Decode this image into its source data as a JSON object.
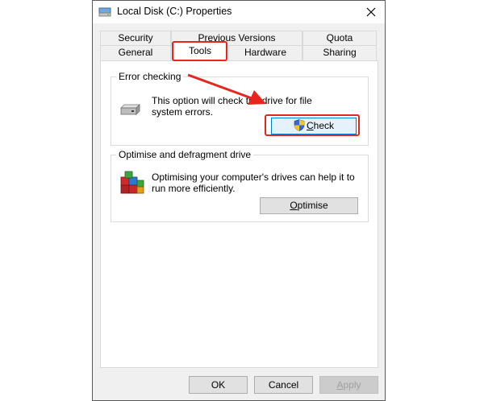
{
  "window": {
    "title": "Local Disk (C:) Properties"
  },
  "tabs_row1": [
    {
      "label": "Security"
    },
    {
      "label": "Previous Versions"
    },
    {
      "label": "Quota"
    }
  ],
  "tabs_row2": [
    {
      "label": "General"
    },
    {
      "label": "Tools",
      "active": true
    },
    {
      "label": "Hardware"
    },
    {
      "label": "Sharing"
    }
  ],
  "error_checking": {
    "title": "Error checking",
    "description": "This option will check the drive for file system errors.",
    "check_button": "Check"
  },
  "optimise": {
    "title": "Optimise and defragment drive",
    "description": "Optimising your computer's drives can help it to run more efficiently.",
    "optimise_button": "Optimise"
  },
  "footer": {
    "ok": "OK",
    "cancel": "Cancel",
    "apply": "Apply"
  },
  "colors": {
    "annotation_red": "#e6251e",
    "focus_blue": "#0078d7"
  },
  "icons": {
    "title": "drive-icon",
    "close": "close-icon",
    "error_check": "hard-drive-icon",
    "shield": "uac-shield-icon",
    "defrag": "defrag-icon"
  }
}
